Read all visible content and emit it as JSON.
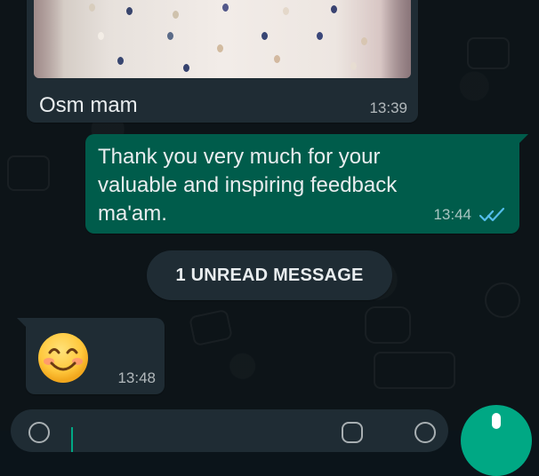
{
  "messages": {
    "incoming_photo": {
      "caption": "Osm mam",
      "time": "13:39"
    },
    "outgoing": {
      "text": "Thank you very much for your valuable and inspiring feedback ma'am.",
      "time": "13:44",
      "status": "read"
    },
    "incoming_emoji": {
      "emoji": "smiling-face-icon",
      "time": "13:48"
    }
  },
  "unread_banner": {
    "label": "1 UNREAD MESSAGE"
  },
  "composer": {
    "placeholder": ""
  }
}
